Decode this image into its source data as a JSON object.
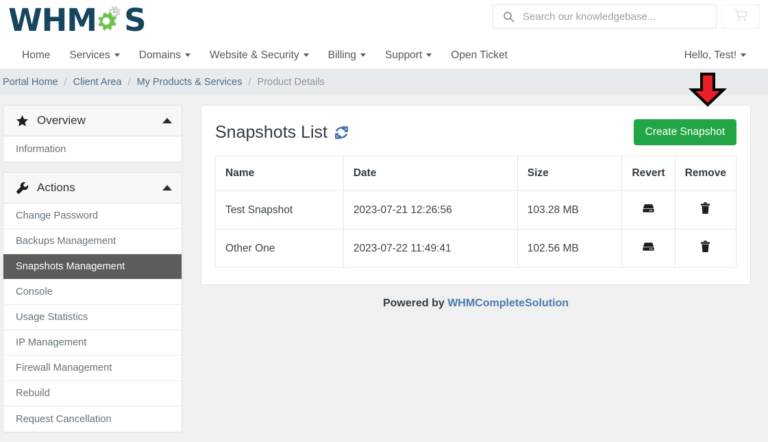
{
  "brand": {
    "logo_text_left": "WHM",
    "logo_text_right": "S",
    "logo_colors": {
      "text": "#16455f",
      "gear_green": "#6cc24a",
      "gear_gray": "#d7d7d7"
    }
  },
  "search": {
    "placeholder": "Search our knowledgebase...",
    "value": "",
    "icon": "search-icon"
  },
  "cart": {
    "icon": "shopping-cart-icon",
    "label": ""
  },
  "nav": {
    "items": [
      {
        "label": "Home",
        "has_caret": false
      },
      {
        "label": "Services",
        "has_caret": true
      },
      {
        "label": "Domains",
        "has_caret": true
      },
      {
        "label": "Website & Security",
        "has_caret": true
      },
      {
        "label": "Billing",
        "has_caret": true
      },
      {
        "label": "Support",
        "has_caret": true
      },
      {
        "label": "Open Ticket",
        "has_caret": false
      }
    ],
    "account": {
      "label": "Hello, Test!",
      "has_caret": true
    }
  },
  "breadcrumb": {
    "items": [
      {
        "label": "Portal Home",
        "active": false
      },
      {
        "label": "Client Area",
        "active": false
      },
      {
        "label": "My Products & Services",
        "active": false
      },
      {
        "label": "Product Details",
        "active": true
      }
    ],
    "separator": "/"
  },
  "sidebar": {
    "panels": [
      {
        "title": "Overview",
        "icon": "star-icon",
        "collapse_icon": "chevron-up-icon",
        "items": [
          {
            "label": "Information",
            "active": false
          }
        ]
      },
      {
        "title": "Actions",
        "icon": "wrench-icon",
        "collapse_icon": "chevron-up-icon",
        "items": [
          {
            "label": "Change Password",
            "active": false
          },
          {
            "label": "Backups Management",
            "active": false
          },
          {
            "label": "Snapshots Management",
            "active": true
          },
          {
            "label": "Console",
            "active": false
          },
          {
            "label": "Usage Statistics",
            "active": false
          },
          {
            "label": "IP Management",
            "active": false
          },
          {
            "label": "Firewall Management",
            "active": false
          },
          {
            "label": "Rebuild",
            "active": false
          },
          {
            "label": "Request Cancellation",
            "active": false
          }
        ]
      }
    ]
  },
  "main": {
    "title": "Snapshots List",
    "refresh_icon": "refresh-sync-icon",
    "create_button": {
      "label": "Create Snapshot",
      "color": "#22a544"
    },
    "table": {
      "columns": [
        "Name",
        "Date",
        "Size",
        "Revert",
        "Remove"
      ],
      "rows": [
        {
          "name": "Test Snapshot",
          "date": "2023-07-21 12:26:56",
          "size": "103.28 MB",
          "revert_icon": "hard-drive-icon",
          "remove_icon": "trash-icon"
        },
        {
          "name": "Other One",
          "date": "2023-07-22 11:49:41",
          "size": "102.56 MB",
          "revert_icon": "hard-drive-icon",
          "remove_icon": "trash-icon"
        }
      ]
    },
    "annotation": {
      "type": "red-down-arrow",
      "color": "#e81f26",
      "points_at": "Create Snapshot"
    }
  },
  "footer": {
    "prefix": "Powered by ",
    "link": "WHMCompleteSolution"
  }
}
